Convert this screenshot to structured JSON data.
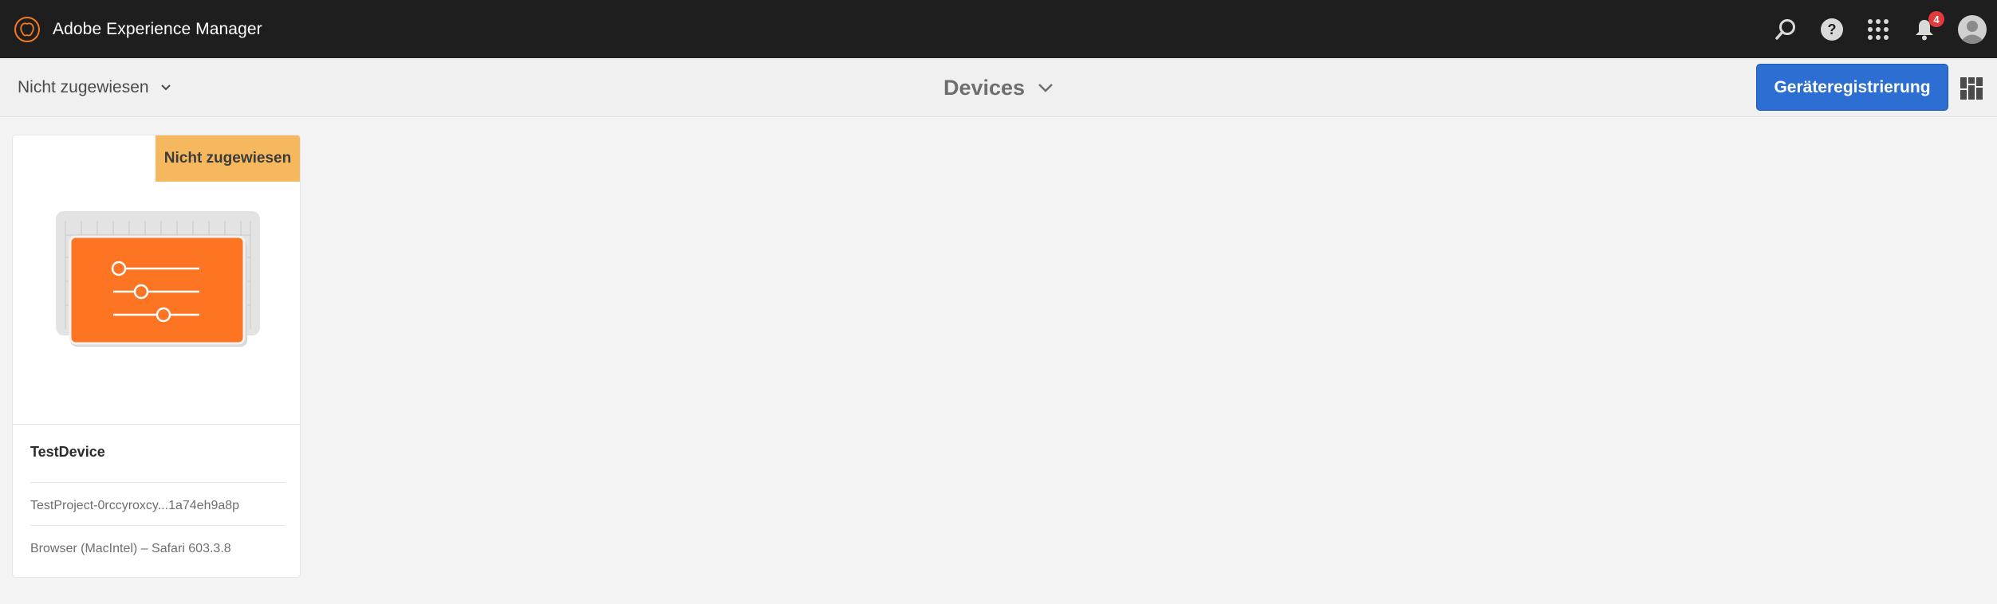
{
  "shell": {
    "app_title": "Adobe Experience Manager",
    "notification_count": "4",
    "icons": [
      "search-icon",
      "help-icon",
      "solutions-grid-icon",
      "bell-icon",
      "user-avatar"
    ]
  },
  "actionbar": {
    "filter_label": "Nicht zugewiesen",
    "title": "Devices",
    "primary_button": "Geräteregistrierung",
    "view_switch_icon": "card-view-icon"
  },
  "card": {
    "status": "Nicht zugewiesen",
    "title": "TestDevice",
    "project": "TestProject-0rccyroxcy...1a74eh9a8p",
    "browser": "Browser (MacIntel) – Safari 603.3.8",
    "thumbnail_icon": "device-config-icon"
  },
  "colors": {
    "shell_bg": "#1e1e1e",
    "accent_blue": "#2d6ed3",
    "status_orange": "#f6b85f",
    "thumbnail_orange": "#fd7522"
  }
}
